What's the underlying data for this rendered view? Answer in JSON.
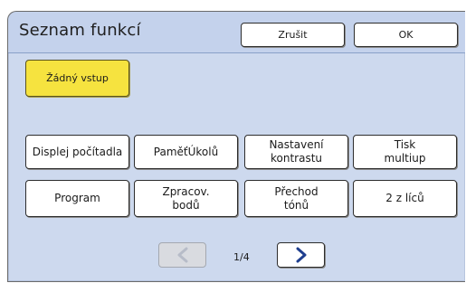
{
  "dialog": {
    "title": "Seznam funkcí",
    "cancel_label": "Zrušit",
    "ok_label": "OK"
  },
  "no_input_label": "Žádný vstup",
  "functions": [
    [
      "Displej počítadla"
    ],
    [
      "PaměťÚkolů"
    ],
    [
      "Nastavení",
      "kontrastu"
    ],
    [
      "Tisk",
      "multiup"
    ],
    [
      "Program"
    ],
    [
      "Zpracov.",
      "bodů"
    ],
    [
      "Přechod",
      "tónů"
    ],
    [
      "2 z líců"
    ]
  ],
  "pager": {
    "text": "1/4",
    "prev_icon": "chevron-left-icon",
    "next_icon": "chevron-right-icon",
    "prev_enabled": false,
    "next_enabled": true
  },
  "colors": {
    "panel": "#cdd9ee",
    "header": "#c4d2ec",
    "highlight": "#f6e33f",
    "chevron_active": "#1f3f8f",
    "chevron_disabled": "#b7bcc8"
  }
}
